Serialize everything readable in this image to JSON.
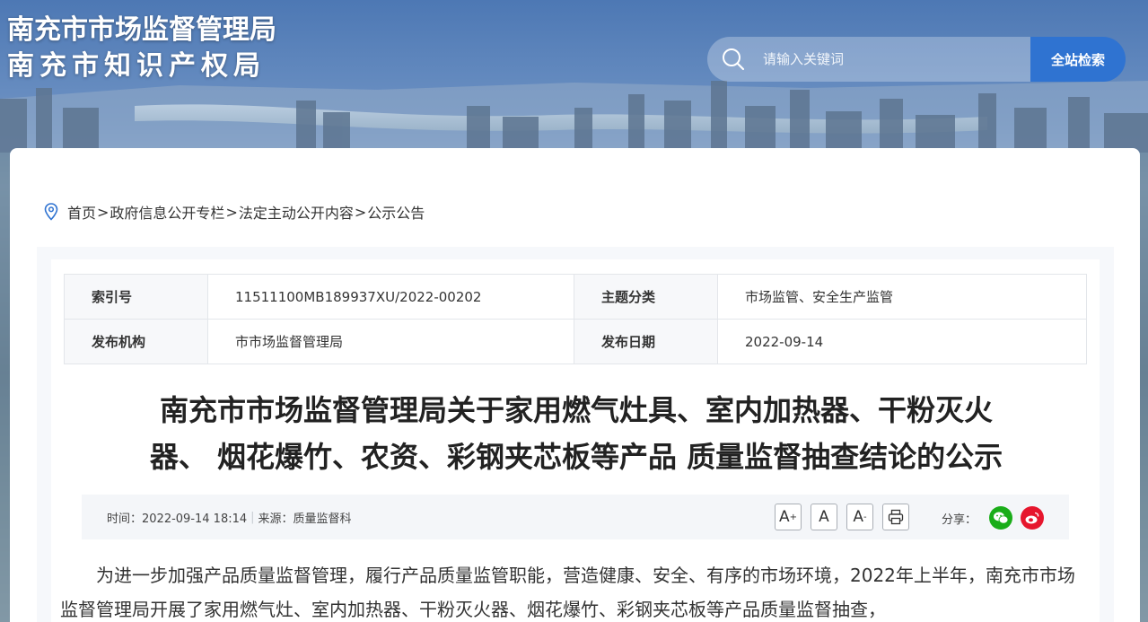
{
  "site": {
    "name_line1": "南充市市场监督管理局",
    "name_line2": "南充市知识产权局"
  },
  "search": {
    "placeholder": "请输入关键词",
    "button_label": "全站检索"
  },
  "breadcrumb": {
    "items": [
      "首页",
      "政府信息公开专栏",
      "法定主动公开内容",
      "公示公告"
    ],
    "separator": ">"
  },
  "meta": {
    "index_label": "索引号",
    "index_value": "11511100MB189937XU/2022-00202",
    "topic_label": "主题分类",
    "topic_value": "市场监管、安全生产监管",
    "publisher_label": "发布机构",
    "publisher_value": "市市场监督管理局",
    "date_label": "发布日期",
    "date_value": "2022-09-14"
  },
  "article": {
    "title_line1": "南充市市场监督管理局关于家用燃气灶具、室内加热器、干粉灭火",
    "title_line2": "器、 烟花爆竹、农资、彩钢夹芯板等产品 质量监督抽查结论的公示",
    "time_text": "时间：2022-09-14 18:14",
    "source_text": "来源：质量监督科",
    "share_label": "分享：",
    "body": "为进一步加强产品质量监督管理，履行产品质量监管职能，营造健康、安全、有序的市场环境，2022年上半年，南充市市场监督管理局开展了家用燃气灶、室内加热器、干粉灭火器、烟花爆竹、彩钢夹芯板等产品质量监督抽查，"
  },
  "tools": {
    "font_larger": "A",
    "font_normal": "A",
    "font_smaller": "A"
  },
  "colors": {
    "accent": "#2f73d1",
    "wechat": "#1aad19",
    "weibo": "#e6162d"
  }
}
